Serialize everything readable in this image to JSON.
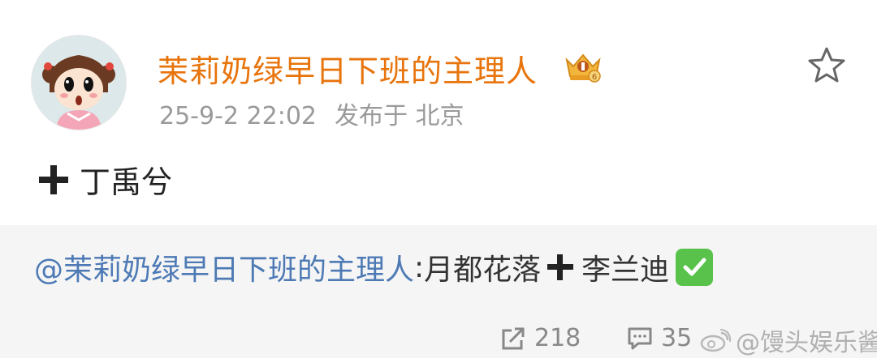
{
  "post": {
    "username": "茉莉奶绿早日下班的主理人",
    "timestamp": "25-9-2 22:02",
    "location": "发布于 北京",
    "badge_icon": "crown-badge-icon",
    "body_plus": "+",
    "body_text": "丁禹兮"
  },
  "repost": {
    "mention": "@茉莉奶绿早日下班的主理人",
    "separator": ":",
    "text_before": "月都花落",
    "text_after": "李兰迪",
    "check_icon": "check-mark-icon"
  },
  "actions": {
    "share_count": "218",
    "comment_count": "35"
  },
  "watermark": {
    "text": "@馒头娱乐酱"
  },
  "colors": {
    "username": "#e8740c",
    "mention": "#4d7ab5",
    "meta": "#9a9a9a",
    "repost_bg": "#f5f5f5",
    "check_bg": "#58c24a"
  }
}
